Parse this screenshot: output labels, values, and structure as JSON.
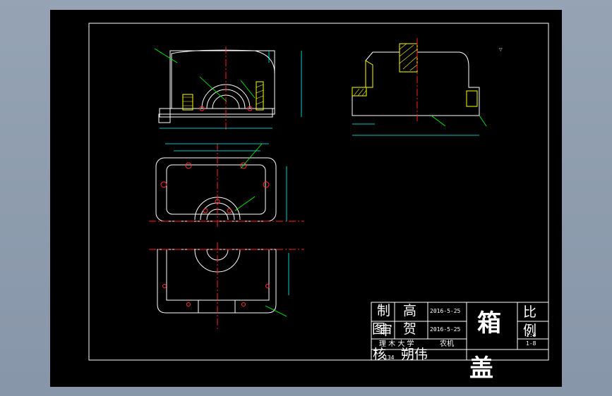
{
  "title_block": {
    "zhi_label": "制",
    "zhi_name": "高",
    "zhi_date": "2016-5-25",
    "tu_label": "图",
    "tu_extra": "审",
    "tu_name": "贺",
    "tu_date": "2016-5-25",
    "school": "理 木 大 学",
    "dept": "农机",
    "check_label": "核",
    "check_num": "134",
    "check_name": "朔伟",
    "part_name_1": "箱",
    "part_name_2": "盖",
    "scale_label_1": "比",
    "scale_label_2": "例",
    "scale_value": "1:8",
    "sheet_value": "1-8"
  },
  "colors": {
    "background": "#000000",
    "line_white": "#ffffff",
    "center_red": "#ff2020",
    "dim_cyan": "#00ffff",
    "hatch_yellow": "#ffff00",
    "leader_green": "#00ff00",
    "hole_red": "#ff3030"
  }
}
